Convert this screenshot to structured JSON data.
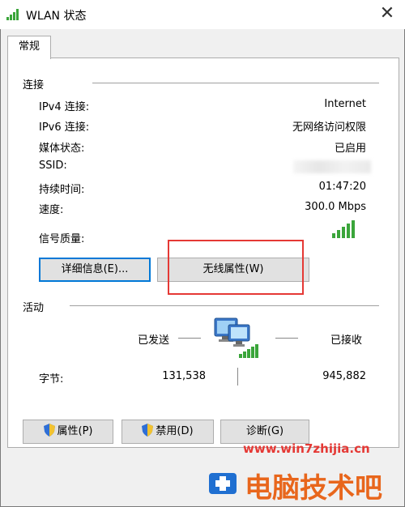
{
  "window": {
    "title": "WLAN 状态",
    "close_glyph": "✕"
  },
  "tabs": [
    {
      "label": "常规"
    }
  ],
  "connection": {
    "section_title": "连接",
    "rows": [
      {
        "label": "IPv4 连接:",
        "value": "Internet"
      },
      {
        "label": "IPv6 连接:",
        "value": "无网络访问权限"
      },
      {
        "label": "媒体状态:",
        "value": "已启用"
      },
      {
        "label": "SSID:",
        "value": ""
      },
      {
        "label": "持续时间:",
        "value": "01:47:20"
      },
      {
        "label": "速度:",
        "value": "300.0 Mbps"
      }
    ],
    "signal_label": "信号质量:",
    "signal_bars": 5,
    "details_button": "详细信息(E)...",
    "wireless_button": "无线属性(W)"
  },
  "activity": {
    "section_title": "活动",
    "sent_label": "已发送",
    "received_label": "已接收",
    "bytes_label": "字节:",
    "bytes_sent": "131,538",
    "bytes_received": "945,882"
  },
  "footer_buttons": {
    "properties": "属性(P)",
    "disable": "禁用(D)",
    "diagnose": "诊断(G)"
  },
  "watermark": {
    "url": "www.win7zhijia.cn",
    "text": "电脑技术吧"
  },
  "colors": {
    "accent": "#0078d7",
    "highlight": "#e53935",
    "signal": "#3aa53a"
  },
  "icons": [
    "signal-icon",
    "close-icon",
    "network-computers-icon",
    "uac-shield-icon"
  ]
}
